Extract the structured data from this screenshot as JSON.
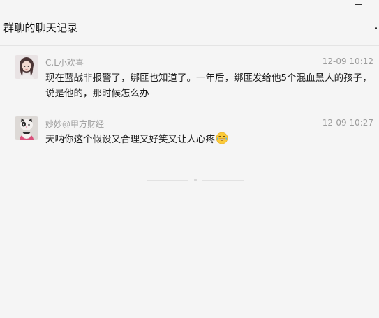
{
  "window": {
    "minimize_icon": "minimize-icon"
  },
  "header": {
    "title": "群聊的聊天记录",
    "more_icon": "more-dots-icon"
  },
  "messages": [
    {
      "sender": "C.L小欢喜",
      "time": "12-09 10:12",
      "text": "现在蓝战非报警了，绑匪也知道了。一年后，绑匪发给他5个混血黑人的孩子，说是他的，那时候怎么办",
      "avatar": "avatar-girl-photo"
    },
    {
      "sender": "妙妙@甲方财经",
      "time": "12-09 10:27",
      "text": "天呐你这个假设又合理又好笑又让人心疼",
      "emoji": "laughing-tears-emoji",
      "avatar": "avatar-cat-toy-photo"
    }
  ],
  "colors": {
    "background": "#f5f5f5",
    "meta_text": "#9c9c9c",
    "divider": "#e6e6e6"
  }
}
